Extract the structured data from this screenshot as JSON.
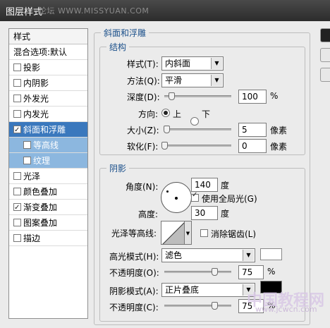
{
  "window": {
    "title": "图层样式",
    "watermark": "论坛 WWW.MISSYUAN.COM"
  },
  "left_panel": {
    "header": "样式",
    "blend_options": "混合选项:默认",
    "items": [
      {
        "label": "投影",
        "checked": false
      },
      {
        "label": "内阴影",
        "checked": false
      },
      {
        "label": "外发光",
        "checked": false
      },
      {
        "label": "内发光",
        "checked": false
      },
      {
        "label": "斜面和浮雕",
        "checked": true,
        "selected": true
      },
      {
        "label": "等高线",
        "checked": false,
        "sub": true
      },
      {
        "label": "纹理",
        "checked": false,
        "sub": true
      },
      {
        "label": "光泽",
        "checked": false
      },
      {
        "label": "颜色叠加",
        "checked": false
      },
      {
        "label": "渐变叠加",
        "checked": true
      },
      {
        "label": "图案叠加",
        "checked": false
      },
      {
        "label": "描边",
        "checked": false
      }
    ]
  },
  "bevel": {
    "title": "斜面和浮雕",
    "structure": {
      "title": "结构",
      "style_label": "样式(T):",
      "style_value": "内斜面",
      "technique_label": "方法(Q):",
      "technique_value": "平滑",
      "depth_label": "深度(D):",
      "depth_value": "100",
      "depth_unit": "%",
      "depth_level": 0.1,
      "direction_label": "方向:",
      "dir_up": "上",
      "dir_down": "下",
      "direction_selected": "上",
      "size_label": "大小(Z):",
      "size_value": "5",
      "size_unit": "像素",
      "size_level": 0.03,
      "soften_label": "软化(F):",
      "soften_value": "0",
      "soften_unit": "像素",
      "soften_level": 0.0
    },
    "shading": {
      "title": "阴影",
      "angle_label": "角度(N):",
      "angle_value": "140",
      "angle_unit": "度",
      "global_light_label": "使用全局光(G)",
      "global_light_checked": true,
      "altitude_label": "高度:",
      "altitude_value": "30",
      "altitude_unit": "度",
      "gloss_contour_label": "光泽等高线:",
      "antialias_label": "消除锯齿(L)",
      "antialias_checked": false,
      "highlight_mode_label": "高光模式(H):",
      "highlight_mode_value": "滤色",
      "highlight_color": "#ffffff",
      "highlight_opacity_label": "不透明度(O):",
      "highlight_opacity_value": "75",
      "highlight_opacity_unit": "%",
      "highlight_opacity_level": 0.75,
      "shadow_mode_label": "阴影模式(A):",
      "shadow_mode_value": "正片叠底",
      "shadow_color": "#000000",
      "shadow_opacity_label": "不透明度(C):",
      "shadow_opacity_value": "75",
      "shadow_opacity_unit": "%",
      "shadow_opacity_level": 0.75
    }
  },
  "site_watermark": {
    "main": "中国教程网",
    "url": "www.jcwcn.com"
  }
}
